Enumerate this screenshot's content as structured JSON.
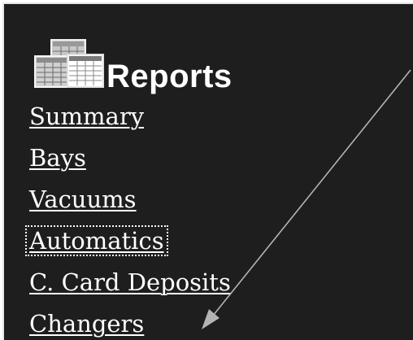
{
  "header": {
    "title": "Reports",
    "icon": "reports-stack-icon"
  },
  "nav": {
    "items": [
      {
        "label": "Summary"
      },
      {
        "label": "Bays"
      },
      {
        "label": "Vacuums"
      },
      {
        "label": "Automatics",
        "focused": true
      },
      {
        "label": "C. Card Deposits"
      },
      {
        "label": "Changers"
      }
    ]
  },
  "colors": {
    "panel_background": "#1e1e1e",
    "text": "#ffffff",
    "annotation_arrow": "#b4b4b4"
  }
}
